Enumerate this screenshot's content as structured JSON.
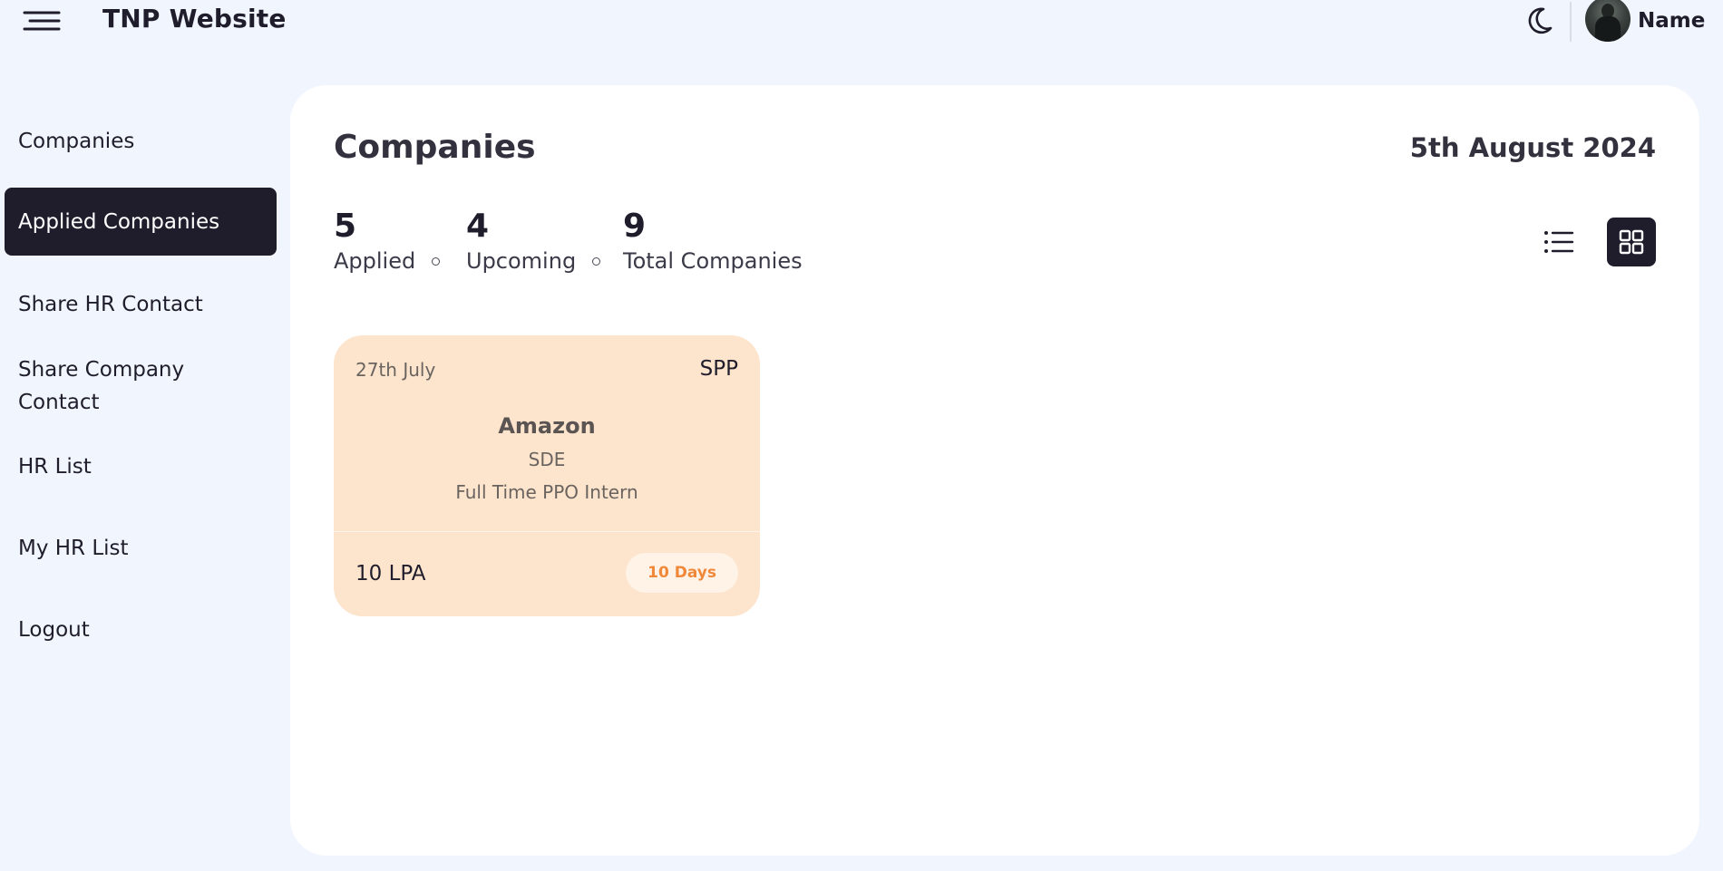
{
  "header": {
    "app_title": "TNP Website",
    "menu_icon": "hamburger-icon",
    "theme_icon": "moon-icon",
    "user_name": "Name"
  },
  "sidebar": {
    "items": [
      {
        "label": "Companies",
        "active": false
      },
      {
        "label": "Applied Companies",
        "active": true
      },
      {
        "label": "Share HR Contact",
        "active": false
      },
      {
        "label": "Share Company Contact",
        "active": false
      },
      {
        "label": "HR List",
        "active": false
      },
      {
        "label": "My HR List",
        "active": false
      },
      {
        "label": "Logout",
        "active": false
      }
    ]
  },
  "main": {
    "title": "Companies",
    "date": "5th August 2024",
    "stats": [
      {
        "value": "5",
        "label": "Applied"
      },
      {
        "value": "4",
        "label": "Upcoming"
      },
      {
        "value": "9",
        "label": "Total Companies"
      }
    ],
    "view_modes": {
      "list_icon": "list-icon",
      "grid_icon": "grid-icon",
      "selected": "grid"
    },
    "cards": [
      {
        "date": "27th July",
        "tag": "SPP",
        "company": "Amazon",
        "role": "SDE",
        "type": "Full Time PPO Intern",
        "salary": "10 LPA",
        "badge": "10 Days"
      }
    ]
  },
  "colors": {
    "background": "#f1f5fe",
    "panel": "#ffffff",
    "dark": "#1f1d2b",
    "card": "#fde4cc",
    "badge_text": "#f0883a"
  }
}
